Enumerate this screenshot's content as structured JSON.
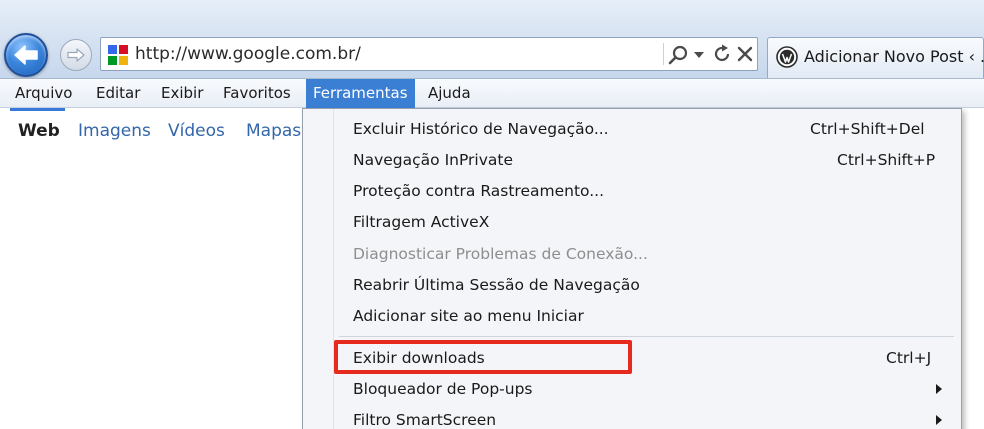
{
  "browser": {
    "address": "http://www.google.com.br/",
    "tab_title": "Adicionar Novo Post ‹ .:"
  },
  "menubar": {
    "items": [
      {
        "label": "Arquivo"
      },
      {
        "label": "Editar"
      },
      {
        "label": "Exibir"
      },
      {
        "label": "Favoritos"
      },
      {
        "label": "Ferramentas"
      },
      {
        "label": "Ajuda"
      }
    ]
  },
  "google_nav": {
    "items": [
      "Web",
      "Imagens",
      "Vídeos",
      "Mapas"
    ]
  },
  "tools_menu": {
    "items": [
      {
        "label": "Excluir Histórico de Navegação...",
        "shortcut": "Ctrl+Shift+Del"
      },
      {
        "label": "Navegação InPrivate",
        "shortcut": "Ctrl+Shift+P"
      },
      {
        "label": "Proteção contra Rastreamento...",
        "shortcut": ""
      },
      {
        "label": "Filtragem ActiveX",
        "shortcut": ""
      },
      {
        "label": "Diagnosticar Problemas de Conexão...",
        "shortcut": "",
        "disabled": true
      },
      {
        "label": "Reabrir Última Sessão de Navegação",
        "shortcut": ""
      },
      {
        "label": "Adicionar site ao menu Iniciar",
        "shortcut": ""
      },
      {
        "label": "Exibir downloads",
        "shortcut": "Ctrl+J"
      },
      {
        "label": "Bloqueador de Pop-ups",
        "shortcut": ""
      },
      {
        "label": "Filtro SmartScreen",
        "shortcut": ""
      }
    ]
  },
  "colors": {
    "menu_active_bg": "#3b7fd5",
    "highlight": "#e62b1e",
    "link": "#3366aa"
  }
}
